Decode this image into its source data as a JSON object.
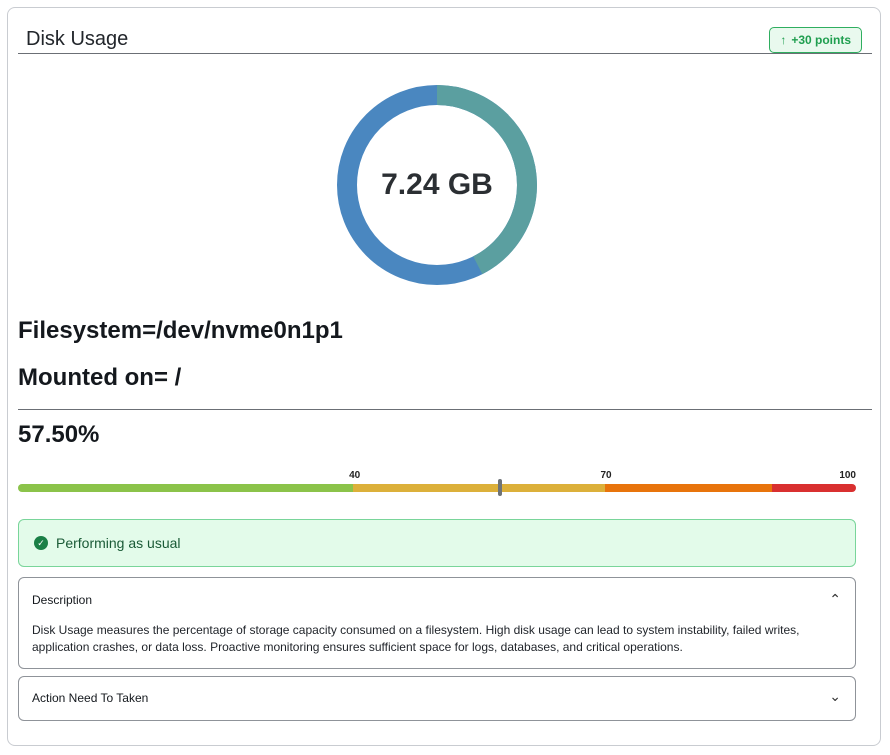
{
  "card": {
    "title": "Disk Usage",
    "badge": {
      "label": "+30 points",
      "icon": "arrow-up-icon"
    }
  },
  "usage_donut": {
    "center_label": "7.24 GB",
    "used_fraction": 0.575,
    "used_color": "#5b9fa0",
    "free_color": "#4a87c0"
  },
  "filesystem_label": "Filesystem=/dev/nvme0n1p1",
  "mount_label": "Mounted on= /",
  "usage_percent_label": "57.50%",
  "gauge": {
    "value": 57.5,
    "max": 100,
    "thresholds": [
      "40",
      "70",
      "100"
    ],
    "segments": [
      {
        "to": 40,
        "color": "#8bc34a"
      },
      {
        "to": 70,
        "color": "#dcb03a"
      },
      {
        "to": 90,
        "color": "#e8740c"
      },
      {
        "to": 100,
        "color": "#d93030"
      }
    ]
  },
  "status": {
    "text": "Performing as usual",
    "icon": "check-circle-icon"
  },
  "description": {
    "title": "Description",
    "text": "Disk Usage measures the percentage of storage capacity consumed on a filesystem. High disk usage can lead to system instability, failed writes, application crashes, or data loss. Proactive monitoring ensures sufficient space for logs, databases, and critical operations.",
    "expanded": true
  },
  "action": {
    "title": "Action Need To Taken",
    "expanded": false
  }
}
